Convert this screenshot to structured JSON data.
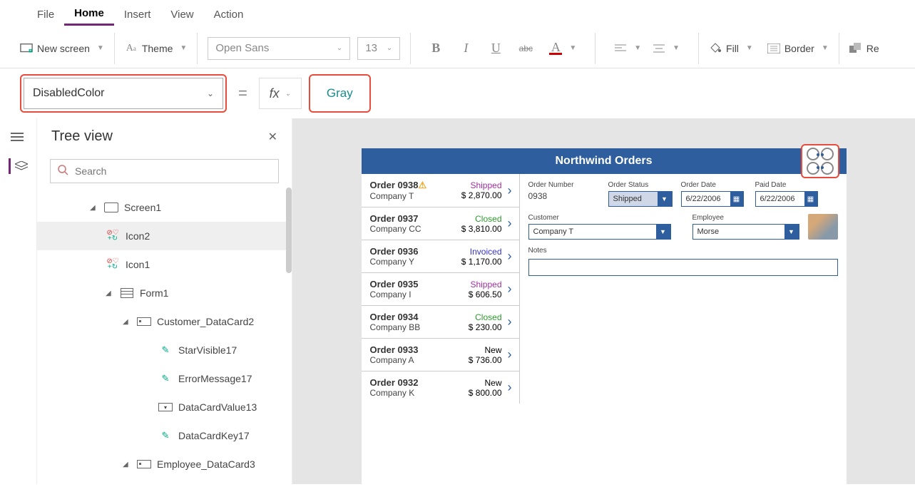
{
  "menu": {
    "file": "File",
    "home": "Home",
    "insert": "Insert",
    "view": "View",
    "action": "Action"
  },
  "ribbon": {
    "new_screen": "New screen",
    "theme": "Theme",
    "font_name": "Open Sans",
    "font_size": "13",
    "fill": "Fill",
    "border": "Border",
    "reorder": "Re"
  },
  "formula": {
    "property": "DisabledColor",
    "fx": "fx",
    "value": "Gray"
  },
  "tree": {
    "title": "Tree view",
    "search_placeholder": "Search",
    "items": [
      {
        "label": "Screen1"
      },
      {
        "label": "Icon2"
      },
      {
        "label": "Icon1"
      },
      {
        "label": "Form1"
      },
      {
        "label": "Customer_DataCard2"
      },
      {
        "label": "StarVisible17"
      },
      {
        "label": "ErrorMessage17"
      },
      {
        "label": "DataCardValue13"
      },
      {
        "label": "DataCardKey17"
      },
      {
        "label": "Employee_DataCard3"
      }
    ]
  },
  "app": {
    "title": "Northwind Orders",
    "orders": [
      {
        "no": "Order 0938",
        "warn": true,
        "company": "Company T",
        "status": "Shipped",
        "status_cls": "st-shipped",
        "amount": "$ 2,870.00"
      },
      {
        "no": "Order 0937",
        "company": "Company CC",
        "status": "Closed",
        "status_cls": "st-closed",
        "amount": "$ 3,810.00"
      },
      {
        "no": "Order 0936",
        "company": "Company Y",
        "status": "Invoiced",
        "status_cls": "st-invoiced",
        "amount": "$ 1,170.00"
      },
      {
        "no": "Order 0935",
        "company": "Company I",
        "status": "Shipped",
        "status_cls": "st-shipped",
        "amount": "$ 606.50"
      },
      {
        "no": "Order 0934",
        "company": "Company BB",
        "status": "Closed",
        "status_cls": "st-closed",
        "amount": "$ 230.00"
      },
      {
        "no": "Order 0933",
        "company": "Company A",
        "status": "New",
        "status_cls": "st-new",
        "amount": "$ 736.00"
      },
      {
        "no": "Order 0932",
        "company": "Company K",
        "status": "New",
        "status_cls": "st-new",
        "amount": "$ 800.00"
      }
    ],
    "detail": {
      "order_number_label": "Order Number",
      "order_number": "0938",
      "order_status_label": "Order Status",
      "order_status": "Shipped",
      "order_date_label": "Order Date",
      "order_date": "6/22/2006",
      "paid_date_label": "Paid Date",
      "paid_date": "6/22/2006",
      "customer_label": "Customer",
      "customer": "Company T",
      "employee_label": "Employee",
      "employee": "Morse",
      "notes_label": "Notes"
    }
  }
}
